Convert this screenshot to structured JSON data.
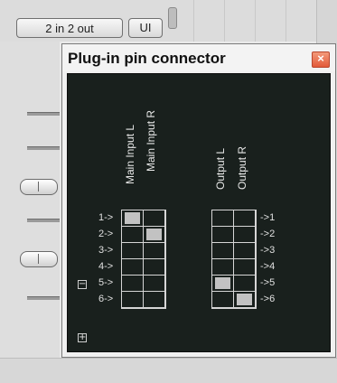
{
  "host": {
    "io_button_label": "2 in 2 out",
    "ui_button_label": "UI"
  },
  "dialog": {
    "title": "Plug-in pin connector",
    "close_glyph": "×",
    "inputs": {
      "channel_names": [
        "Main Input L",
        "Main Input R"
      ],
      "row_labels": [
        "1->",
        "2->",
        "3->",
        "4->",
        "5->",
        "6->"
      ],
      "matrix": [
        [
          true,
          false
        ],
        [
          false,
          true
        ],
        [
          false,
          false
        ],
        [
          false,
          false
        ],
        [
          false,
          false
        ],
        [
          false,
          false
        ]
      ]
    },
    "outputs": {
      "channel_names": [
        "Output L",
        "Output R"
      ],
      "row_labels": [
        "->1",
        "->2",
        "->3",
        "->4",
        "->5",
        "->6"
      ],
      "matrix": [
        [
          false,
          false
        ],
        [
          false,
          false
        ],
        [
          false,
          false
        ],
        [
          false,
          false
        ],
        [
          true,
          false
        ],
        [
          false,
          true
        ]
      ]
    },
    "remove_channel_glyph": "−",
    "add_channel_glyph": "+"
  },
  "colors": {
    "panel_bg": "#19201d",
    "active_pin": "#c2c2c2",
    "close_button": "#e35a3a"
  }
}
